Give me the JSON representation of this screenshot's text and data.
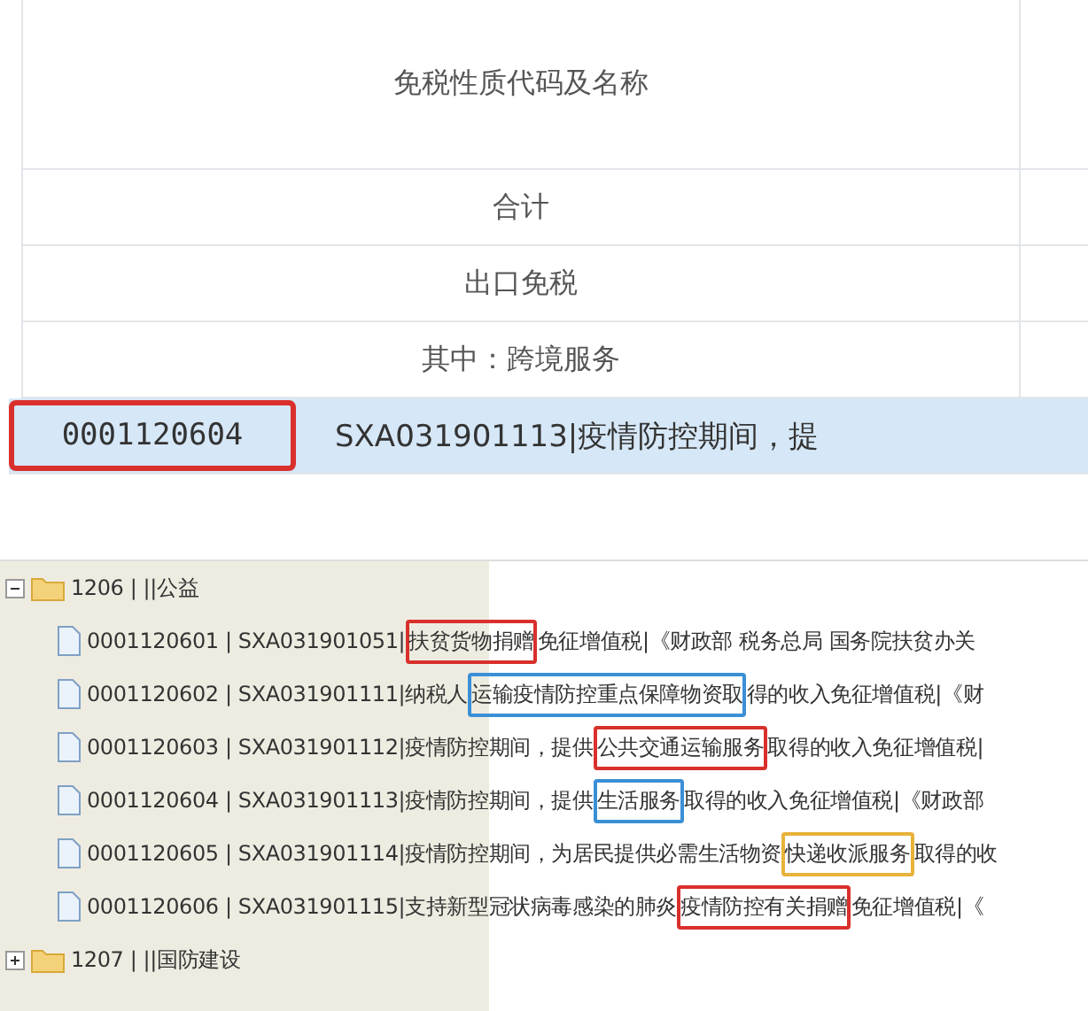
{
  "table": {
    "header": "免税性质代码及名称",
    "rows": [
      {
        "kind": "label",
        "text": "合计",
        "selected": false
      },
      {
        "kind": "label",
        "text": "出口免税",
        "selected": false
      },
      {
        "kind": "label",
        "text": "其中：跨境服务",
        "selected": false
      },
      {
        "kind": "code",
        "code": "0001120604",
        "name": "SXA031901113|疫情防控期间，提",
        "selected": true,
        "color": "#d9302c"
      }
    ]
  },
  "tree": [
    {
      "label": "1206 | ||公益",
      "expanded": true,
      "children": [
        {
          "parts": [
            {
              "text": "0001120601 | SXA031901051|"
            },
            {
              "text": "扶贫货物捐赠",
              "color": "#d9302c"
            },
            {
              "text": "免征增值税|《财政部 税务总局 国务院扶贫办关"
            }
          ]
        },
        {
          "parts": [
            {
              "text": "0001120602 | SXA031901111|纳税人"
            },
            {
              "text": "运输疫情防控重点保障物资取",
              "color": "#3a8fd6"
            },
            {
              "text": "得的收入免征增值税|《财"
            }
          ]
        },
        {
          "parts": [
            {
              "text": "0001120603 | SXA031901112|疫情防控期间，提供"
            },
            {
              "text": "公共交通运输服务",
              "color": "#d9302c"
            },
            {
              "text": "取得的收入免征增值税|"
            }
          ]
        },
        {
          "parts": [
            {
              "text": "0001120604 | SXA031901113|疫情防控期间，提供"
            },
            {
              "text": "生活服务",
              "color": "#3a8fd6"
            },
            {
              "text": "取得的收入免征增值税|《财政部"
            }
          ]
        },
        {
          "parts": [
            {
              "text": "0001120605 | SXA031901114|疫情防控期间，为居民提供必需生活物资"
            },
            {
              "text": "快递收派服务",
              "color": "#e8b23a"
            },
            {
              "text": "取得的收"
            }
          ]
        },
        {
          "parts": [
            {
              "text": "0001120606 | SXA031901115|支持新型冠状病毒感染的肺炎"
            },
            {
              "text": "疫情防控有关捐赠",
              "color": "#d9302c"
            },
            {
              "text": "免征增值税|《"
            }
          ]
        }
      ]
    },
    {
      "label": "1207 | ||国防建设",
      "expanded": false
    }
  ]
}
